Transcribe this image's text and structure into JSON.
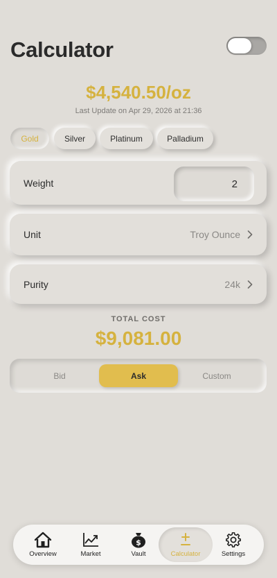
{
  "header": {
    "title": "Calculator",
    "dark_mode": false
  },
  "price": {
    "value": "$4,540.50/oz",
    "last_update": "Last Update on Apr 29, 2026 at 21:36"
  },
  "metals": {
    "items": [
      {
        "label": "Gold",
        "active": true
      },
      {
        "label": "Silver",
        "active": false
      },
      {
        "label": "Platinum",
        "active": false
      },
      {
        "label": "Palladium",
        "active": false
      }
    ]
  },
  "inputs": {
    "weight": {
      "label": "Weight",
      "value": "2"
    },
    "unit": {
      "label": "Unit",
      "value": "Troy Ounce"
    },
    "purity": {
      "label": "Purity",
      "value": "24k"
    }
  },
  "total": {
    "label": "TOTAL COST",
    "value": "$9,081.00"
  },
  "price_mode": {
    "options": [
      {
        "label": "Bid",
        "active": false
      },
      {
        "label": "Ask",
        "active": true
      },
      {
        "label": "Custom",
        "active": false
      }
    ]
  },
  "tab_bar": {
    "items": [
      {
        "label": "Overview",
        "icon": "home-icon",
        "active": false
      },
      {
        "label": "Market",
        "icon": "chart-icon",
        "active": false
      },
      {
        "label": "Vault",
        "icon": "money-bag-icon",
        "active": false
      },
      {
        "label": "Calculator",
        "icon": "plus-minus-icon",
        "active": true
      },
      {
        "label": "Settings",
        "icon": "gear-icon",
        "active": false
      }
    ]
  },
  "colors": {
    "accent": "#d5b23f",
    "background": "#e0ddd8",
    "active_segment": "#e1bd4e"
  }
}
